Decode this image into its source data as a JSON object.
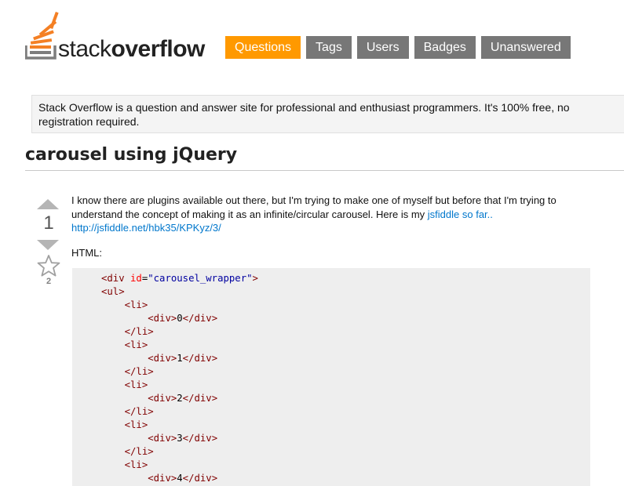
{
  "header": {
    "logo_text_light": "stack",
    "logo_text_bold": "overflow",
    "nav": [
      {
        "label": "Questions",
        "active": true
      },
      {
        "label": "Tags",
        "active": false
      },
      {
        "label": "Users",
        "active": false
      },
      {
        "label": "Badges",
        "active": false
      },
      {
        "label": "Unanswered",
        "active": false
      }
    ]
  },
  "notice": "Stack Overflow is a question and answer site for professional and enthusiast programmers. It's 100% free, no registration required.",
  "question": {
    "title": "carousel using jQuery",
    "votes": "1",
    "favorites": "2",
    "body_line1": "I know there are plugins available out there, but I'm trying to make one of myself but before that I'm trying to understand the concept of making it as an infinite/circular carousel. Here is my ",
    "link1": "jsfiddle so far..",
    "link2": "http://jsfiddle.net/hbk35/KPKyz/3/",
    "html_label": "HTML:"
  },
  "code": {
    "div_open_tag": "<div",
    "attr_name": "id",
    "attr_eq": "=",
    "attr_value": "\"carousel_wrapper\"",
    "gt": ">",
    "ul_open": "<ul>",
    "li_open": "<li>",
    "li_close": "</li>",
    "div_open": "<div>",
    "div_close": "</div>",
    "items": [
      "0",
      "1",
      "2",
      "3",
      "4"
    ]
  },
  "colors": {
    "accent": "#ff9900",
    "nav_bg": "#777777",
    "link": "#0077cc",
    "code_bg": "#eeeeee"
  },
  "icons": [
    "stack-overflow-logo-icon",
    "vote-up-arrow-icon",
    "vote-down-arrow-icon",
    "star-icon"
  ]
}
